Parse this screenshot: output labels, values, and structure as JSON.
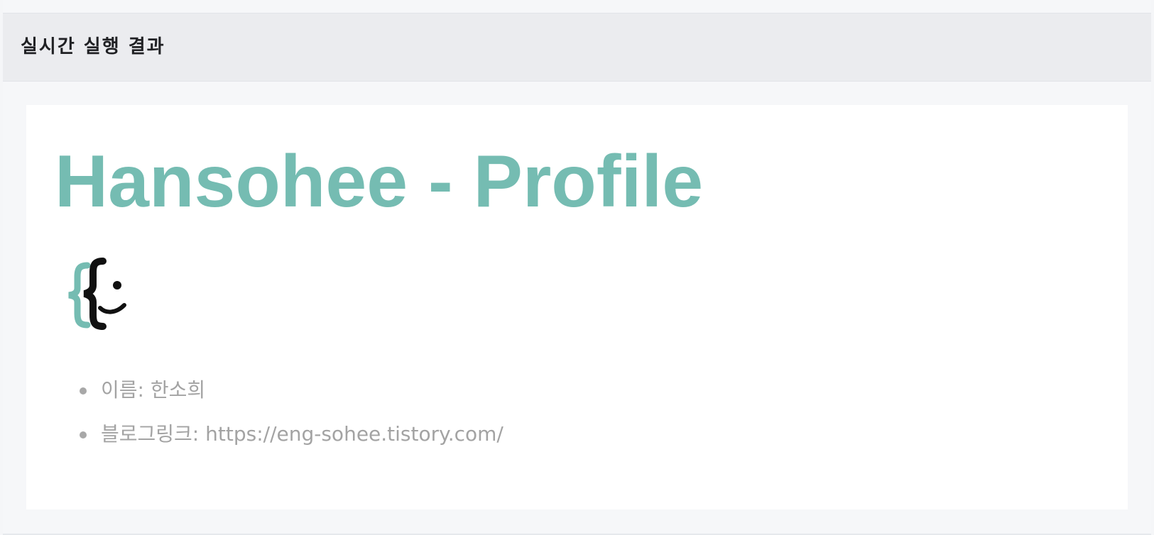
{
  "panel": {
    "title": "실시간 실행 결과"
  },
  "profile": {
    "heading": "Hansohee - Profile",
    "logo_icon": "curly-brace-smile-logo-icon",
    "accent_color": "#75bcb2",
    "items": [
      {
        "label": "이름: 한소희"
      },
      {
        "label": "블로그링크: https://eng-sohee.tistory.com/"
      }
    ]
  }
}
